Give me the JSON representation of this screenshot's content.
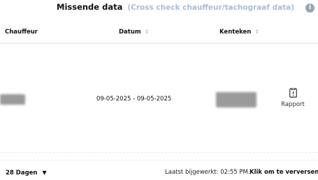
{
  "header": {
    "title": "Missende data",
    "subtitle": "(Cross check chauffeur/tachograaf data)",
    "info_icon": "info-icon"
  },
  "table": {
    "columns": [
      {
        "label": "Chauffeur",
        "sortable": false
      },
      {
        "label": "Datum",
        "sortable": true
      },
      {
        "label": "Kenteken",
        "sortable": true
      }
    ],
    "sort_icon": "sort-icon",
    "rows": [
      {
        "chauffeur": "",
        "datum": "09-05-2025 - 09-05-2025",
        "kenteken": "",
        "action": {
          "label": "Rapport",
          "icon": "report-icon"
        }
      }
    ]
  },
  "footer": {
    "period_label": "28 Dagen",
    "period_icon": "caret-down-icon",
    "updated_text": "Laatst bijgewerkt: 02:55 PM.",
    "refresh_link": "Klik om te verversen."
  },
  "colors": {
    "subtitle": "#a9bdd6",
    "separator": "#e6eef8",
    "info_bg": "#9aa6b4"
  }
}
